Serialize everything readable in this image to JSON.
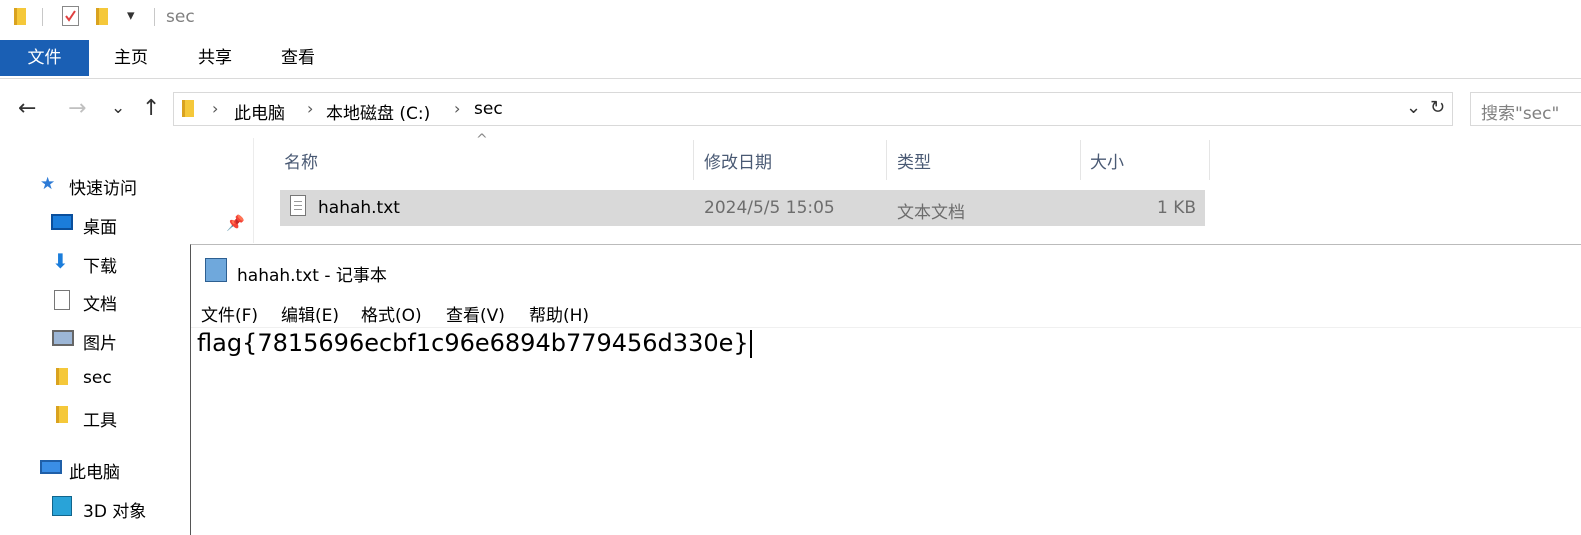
{
  "quick_access_toolbar": {
    "title": "sec",
    "dropdown_glyph": "▾"
  },
  "ribbon": {
    "tabs": [
      "文件",
      "主页",
      "共享",
      "查看"
    ]
  },
  "address_bar": {
    "back_glyph": "←",
    "forward_glyph": "→",
    "recent_glyph": "⌄",
    "up_glyph": "↑",
    "breadcrumbs": [
      "此电脑",
      "本地磁盘 (C:)",
      "sec"
    ],
    "separator": "›",
    "dropdown_glyph": "⌄",
    "refresh_glyph": "↻",
    "search_placeholder": "搜索\"sec\""
  },
  "nav_pane": {
    "quick_access_label": "快速访问",
    "items": [
      "桌面",
      "下载",
      "文档",
      "图片",
      "sec",
      "工具"
    ],
    "this_pc_label": "此电脑",
    "this_pc_items": [
      "3D 对象"
    ]
  },
  "file_list": {
    "sort_glyph": "^",
    "columns": [
      "名称",
      "修改日期",
      "类型",
      "大小"
    ],
    "rows": [
      {
        "name": "hahah.txt",
        "modified": "2024/5/5 15:05",
        "type": "文本文档",
        "size": "1 KB"
      }
    ]
  },
  "notepad": {
    "title": "hahah.txt - 记事本",
    "menu": [
      "文件(F)",
      "编辑(E)",
      "格式(O)",
      "查看(V)",
      "帮助(H)"
    ],
    "content": "flag{7815696ecbf1c96e6894b779456d330e}"
  },
  "colors": {
    "file_tab_bg": "#1a5fb4",
    "selection_bg": "#d9d9d9",
    "folder_yellow": "#f5c83a"
  }
}
